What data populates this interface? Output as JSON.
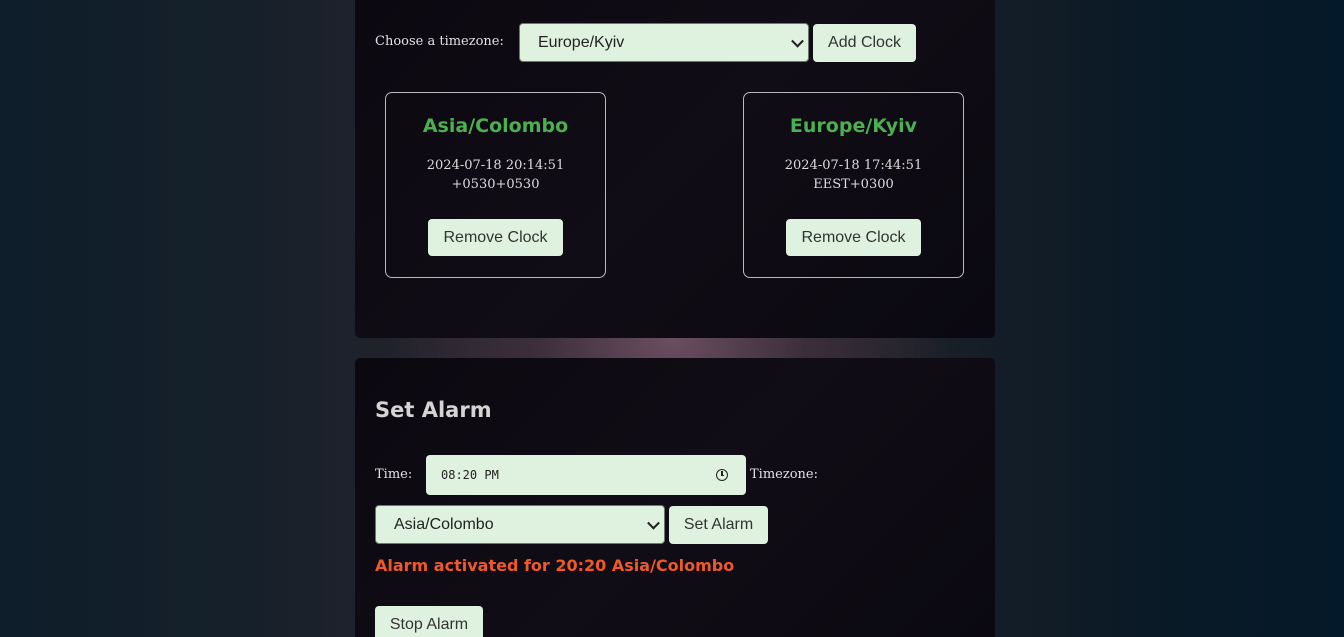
{
  "clocks_panel": {
    "timezone_label": "Choose a timezone:",
    "timezone_selected": "Europe/Kyiv",
    "add_button": "Add Clock",
    "clocks": [
      {
        "name": "Asia/Colombo",
        "datetime": "2024-07-18 20:14:51",
        "offset": "+0530+0530",
        "remove_label": "Remove Clock"
      },
      {
        "name": "Europe/Kyiv",
        "datetime": "2024-07-18 17:44:51",
        "offset": "EEST+0300",
        "remove_label": "Remove Clock"
      }
    ]
  },
  "alarm_panel": {
    "title": "Set Alarm",
    "time_label": "Time:",
    "time_value": "08:20 PM",
    "timezone_label": "Timezone:",
    "timezone_selected": "Asia/Colombo",
    "set_button": "Set Alarm",
    "status": "Alarm activated for 20:20 Asia/Colombo",
    "stop_button": "Stop Alarm"
  },
  "colors": {
    "accent_green": "#4caf50",
    "control_bg": "#dff1df",
    "alert_orange": "#f0582a"
  }
}
